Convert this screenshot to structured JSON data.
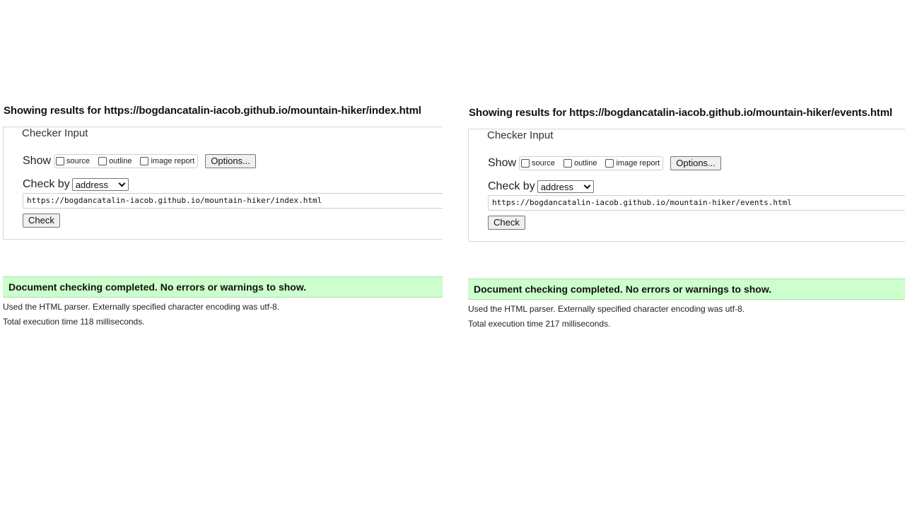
{
  "panels": [
    {
      "heading": "Showing results for https://bogdancatalin-iacob.github.io/mountain-hiker/index.html",
      "legend": "Checker Input",
      "show_label": "Show",
      "show_options": [
        "source",
        "outline",
        "image report"
      ],
      "options_button": "Options...",
      "check_by_label": "Check by",
      "check_by_value": "address",
      "url_value": "https://bogdancatalin-iacob.github.io/mountain-hiker/index.html",
      "check_button": "Check",
      "status": "Document checking completed. No errors or warnings to show.",
      "parser_info": "Used the HTML parser. Externally specified character encoding was utf-8.",
      "execution_time": "Total execution time 118 milliseconds."
    },
    {
      "heading": "Showing results for https://bogdancatalin-iacob.github.io/mountain-hiker/events.html",
      "legend": "Checker Input",
      "show_label": "Show",
      "show_options": [
        "source",
        "outline",
        "image report"
      ],
      "options_button": "Options...",
      "check_by_label": "Check by",
      "check_by_value": "address",
      "url_value": "https://bogdancatalin-iacob.github.io/mountain-hiker/events.html",
      "check_button": "Check",
      "status": "Document checking completed. No errors or warnings to show.",
      "parser_info": "Used the HTML parser. Externally specified character encoding was utf-8.",
      "execution_time": "Total execution time 217 milliseconds."
    }
  ],
  "colors": {
    "status_background": "#ccffcc",
    "border": "#d7d7d7"
  }
}
